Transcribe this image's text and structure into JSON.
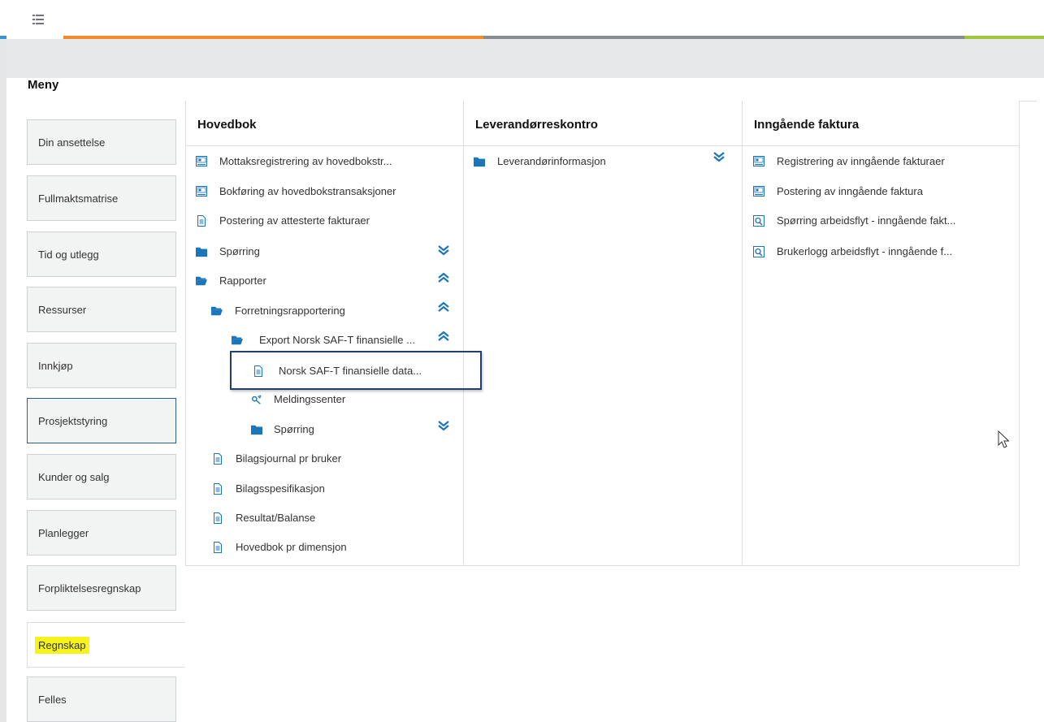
{
  "header": {
    "menu_icon": "list-icon",
    "accent_colors": [
      "#f08a2a",
      "#878c90",
      "#9fc73b"
    ]
  },
  "page": {
    "title": "Meny"
  },
  "sidebar": {
    "items": [
      {
        "label": "Din ansettelse"
      },
      {
        "label": "Fullmaktsmatrise"
      },
      {
        "label": "Tid og utlegg"
      },
      {
        "label": "Ressurser"
      },
      {
        "label": "Innkjøp"
      },
      {
        "label": "Prosjektstyring"
      },
      {
        "label": "Kunder og salg"
      },
      {
        "label": "Planlegger"
      },
      {
        "label": "Forpliktelsesregnskap"
      },
      {
        "label": "Regnskap"
      },
      {
        "label": "Felles"
      }
    ],
    "selected": "Regnskap",
    "highlight_color": "#f6f31a"
  },
  "columns": [
    {
      "title": "Hovedbok",
      "items": [
        {
          "label": "Mottaksregistrering av hovedbokstr...",
          "icon": "form-icon"
        },
        {
          "label": "Bokføring av hovedbokstransaksjoner",
          "icon": "form-icon"
        },
        {
          "label": "Postering av attesterte fakturaer",
          "icon": "document-icon"
        },
        {
          "label": "Spørring",
          "icon": "folder-icon",
          "toggle": "expand"
        },
        {
          "label": "Rapporter",
          "icon": "folder-open-icon",
          "toggle": "collapse"
        },
        {
          "label": "Forretningsrapportering",
          "icon": "folder-open-icon",
          "toggle": "collapse"
        },
        {
          "label": "Export Norsk SAF-T finansielle ...",
          "icon": "folder-open-icon",
          "toggle": "collapse"
        },
        {
          "label": "Norsk SAF-T finansielle data...",
          "icon": "document-icon"
        },
        {
          "label": "Meldingssenter",
          "icon": "satellite-icon"
        },
        {
          "label": "Spørring",
          "icon": "folder-icon",
          "toggle": "expand"
        },
        {
          "label": "Bilagsjournal pr bruker",
          "icon": "document-icon"
        },
        {
          "label": "Bilagsspesifikasjon",
          "icon": "document-icon"
        },
        {
          "label": "Resultat/Balanse",
          "icon": "document-icon"
        },
        {
          "label": "Hovedbok pr dimensjon",
          "icon": "document-icon"
        }
      ]
    },
    {
      "title": "Leverandørreskontro",
      "items": [
        {
          "label": "Leverandørinformasjon",
          "icon": "folder-icon",
          "toggle": "expand"
        }
      ]
    },
    {
      "title": "Inngående faktura",
      "items": [
        {
          "label": "Registrering av inngående fakturaer",
          "icon": "form-icon"
        },
        {
          "label": "Postering av inngående faktura",
          "icon": "form-icon"
        },
        {
          "label": "Spørring arbeidsflyt - inngående fakt...",
          "icon": "search-doc-icon"
        },
        {
          "label": "Brukerlogg arbeidsflyt - inngående f...",
          "icon": "search-doc-icon"
        }
      ]
    }
  ],
  "colors": {
    "icon_blue": "#1b75bb",
    "selection_border": "#1f3f6c"
  }
}
